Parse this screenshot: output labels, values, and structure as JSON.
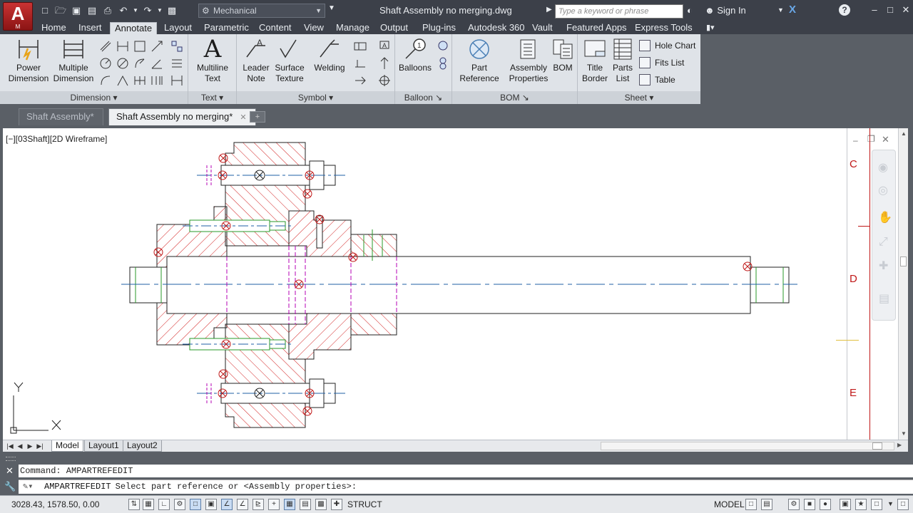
{
  "titlebar": {
    "logo_text": "A",
    "logo_sub": "M",
    "workspace": "Mechanical",
    "title": "Shaft Assembly no merging.dwg",
    "search_placeholder": "Type a keyword or phrase",
    "sign_in": "Sign In"
  },
  "ribbon_tabs": [
    "Home",
    "Insert",
    "Annotate",
    "Layout",
    "Parametric",
    "Content",
    "View",
    "Manage",
    "Output",
    "Plug-ins",
    "Autodesk 360",
    "Vault",
    "Featured Apps",
    "Express Tools"
  ],
  "active_tab": "Annotate",
  "panels": {
    "dimension": {
      "title": "Dimension",
      "power_dimension": [
        "Power",
        "Dimension"
      ],
      "multiple_dimension": [
        "Multiple",
        "Dimension"
      ]
    },
    "text": {
      "title": "Text",
      "multiline_text": [
        "Multiline",
        "Text"
      ]
    },
    "symbol": {
      "title": "Symbol",
      "leader_note": [
        "Leader",
        "Note"
      ],
      "surface_texture": [
        "Surface",
        "Texture"
      ],
      "welding": "Welding"
    },
    "balloon": {
      "title": "Balloon",
      "balloons": "Balloons"
    },
    "bom": {
      "title": "BOM",
      "part_reference": [
        "Part",
        "Reference"
      ],
      "assembly_properties": [
        "Assembly",
        "Properties"
      ],
      "bom": "BOM"
    },
    "sheet": {
      "title": "Sheet",
      "title_border": [
        "Title",
        "Border"
      ],
      "parts_list": [
        "Parts",
        "List"
      ],
      "hole_chart": "Hole Chart",
      "fits_list": "Fits List",
      "table": "Table"
    }
  },
  "doc_tabs": [
    {
      "label": "Shaft Assembly*",
      "active": false
    },
    {
      "label": "Shaft Assembly no merging*",
      "active": true
    }
  ],
  "viewport": {
    "label": "[−][03Shaft][2D Wireframe]",
    "ucs_x": "X",
    "ucs_y": "Y"
  },
  "border_letters": [
    "C",
    "D",
    "E"
  ],
  "layout_tabs": [
    "Model",
    "Layout1",
    "Layout2"
  ],
  "command": {
    "history": "Command: AMPARTREFEDIT",
    "current_name": "AMPARTREFEDIT",
    "current_prompt": "Select part reference or <Assembly properties>:"
  },
  "status": {
    "coords": "3028.43, 1578.50, 0.00",
    "struct": "STRUCT",
    "model": "MODEL"
  },
  "colors": {
    "titlebar": "#3c4049",
    "ribbon": "#dfe3e8",
    "hatch": "#d22020",
    "centerline": "#1f5fa6",
    "hidden": "#b400b4",
    "logo": "#c93333"
  }
}
